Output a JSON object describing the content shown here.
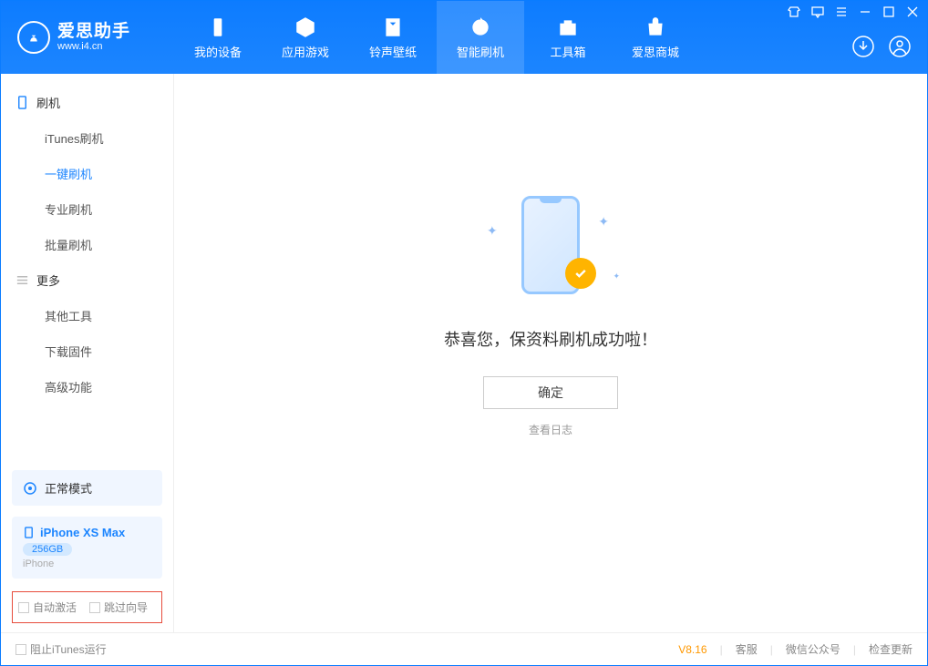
{
  "logo": {
    "main": "爱思助手",
    "sub": "www.i4.cn"
  },
  "tabs": {
    "device": "我的设备",
    "apps": "应用游戏",
    "ringtones": "铃声壁纸",
    "flash": "智能刷机",
    "toolbox": "工具箱",
    "store": "爱思商城"
  },
  "sidebar": {
    "section_flash": "刷机",
    "items": {
      "itunes": "iTunes刷机",
      "oneclick": "一键刷机",
      "pro": "专业刷机",
      "batch": "批量刷机"
    },
    "section_more": "更多",
    "more_items": {
      "other": "其他工具",
      "firmware": "下载固件",
      "advanced": "高级功能"
    }
  },
  "mode": {
    "label": "正常模式"
  },
  "device": {
    "name": "iPhone XS Max",
    "capacity": "256GB",
    "type": "iPhone"
  },
  "options": {
    "auto_activate": "自动激活",
    "skip_guide": "跳过向导"
  },
  "result": {
    "message": "恭喜您，保资料刷机成功啦！",
    "ok": "确定",
    "view_log": "查看日志"
  },
  "footer": {
    "block_itunes": "阻止iTunes运行",
    "version": "V8.16",
    "support": "客服",
    "wechat": "微信公众号",
    "update": "检查更新"
  }
}
